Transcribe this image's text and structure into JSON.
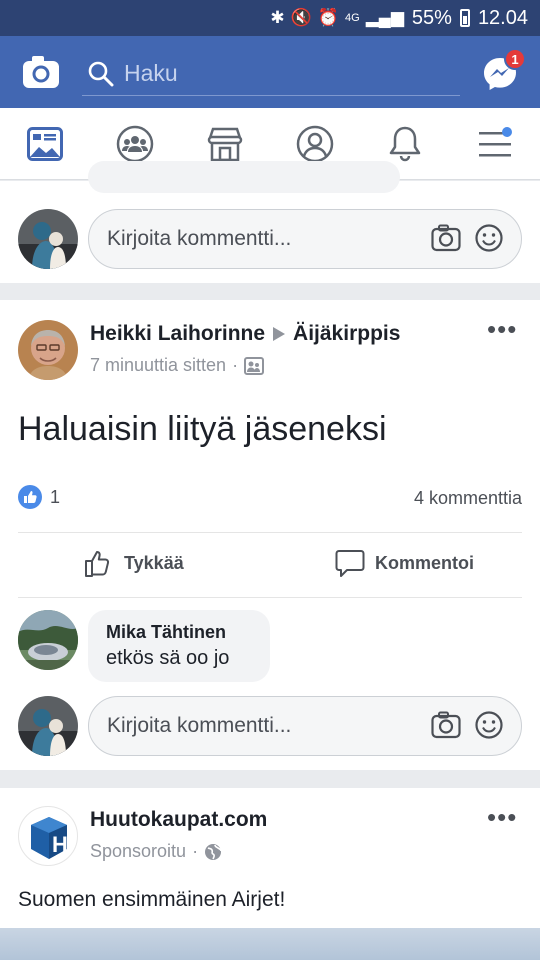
{
  "status_bar": {
    "signal": "4G",
    "battery": "55%",
    "time": "12.04"
  },
  "top_bar": {
    "search_placeholder": "Haku",
    "messenger_badge": "1"
  },
  "colors": {
    "brand": "#4267b2",
    "status": "#2d4373",
    "badge": "#e43a3a",
    "like": "#4a8ae8"
  },
  "nav": {
    "items": [
      {
        "name": "news-feed",
        "icon": "news-feed-icon"
      },
      {
        "name": "groups",
        "icon": "groups-icon"
      },
      {
        "name": "marketplace",
        "icon": "marketplace-icon"
      },
      {
        "name": "profile",
        "icon": "profile-icon"
      },
      {
        "name": "notifications",
        "icon": "bell-icon"
      },
      {
        "name": "menu",
        "icon": "hamburger-menu-icon"
      }
    ]
  },
  "top_comment_box": {
    "placeholder": "Kirjoita kommentti..."
  },
  "post": {
    "author": "Heikki Laihorinne",
    "group": "Äijäkirppis",
    "time": "7 minuuttia sitten",
    "text": "Haluaisin liityä jäseneksi",
    "likes": "1",
    "comments_count": "4 kommenttia",
    "like_label": "Tykkää",
    "comment_label": "Kommentoi",
    "comment": {
      "author": "Mika Tähtinen",
      "text": "etkös sä oo jo"
    },
    "comment_box_placeholder": "Kirjoita kommentti..."
  },
  "ad": {
    "name": "Huutokaupat.com",
    "sponsored": "Sponsoroitu",
    "text": "Suomen ensimmäinen Airjet!"
  }
}
